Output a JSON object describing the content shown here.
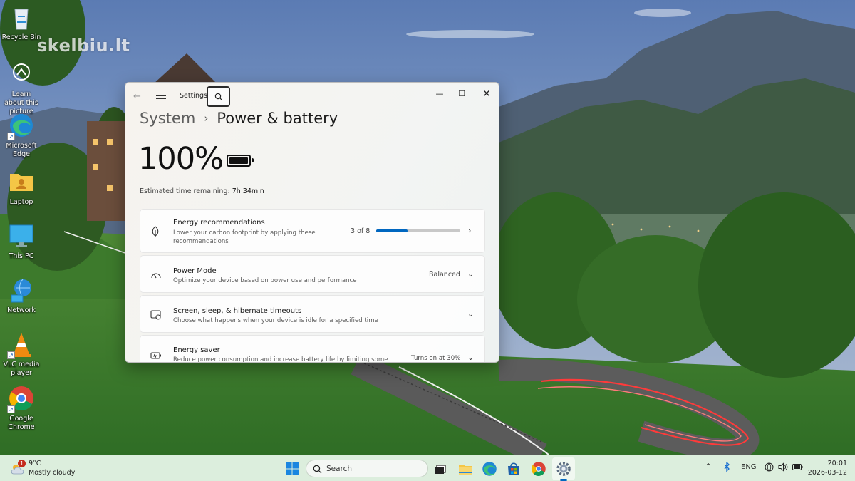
{
  "watermark": "skelbiu.lt",
  "desktop_icons": [
    {
      "label": "Recycle Bin",
      "icon": "recycle-bin-icon"
    },
    {
      "label": "Learn about this picture",
      "icon": "camera-info-icon"
    },
    {
      "label": "Microsoft Edge",
      "icon": "edge-icon"
    },
    {
      "label": "Laptop",
      "icon": "user-folder-icon"
    },
    {
      "label": "This PC",
      "icon": "monitor-icon"
    },
    {
      "label": "Network",
      "icon": "network-icon"
    },
    {
      "label": "VLC media player",
      "icon": "vlc-cone-icon"
    },
    {
      "label": "Google Chrome",
      "icon": "chrome-icon"
    }
  ],
  "settings": {
    "app_title": "Settings",
    "breadcrumb_parent": "System",
    "breadcrumb_current": "Power & battery",
    "battery_percent": "100%",
    "battery_level": 1.0,
    "estimate_label": "Estimated time remaining:",
    "estimate_value": "7h 34min",
    "cards": [
      {
        "icon": "leaf-icon",
        "title": "Energy recommendations",
        "subtitle": "Lower your carbon footprint by applying these recommendations",
        "value": "3 of 8",
        "progress": 0.375
      },
      {
        "icon": "power-mode-icon",
        "title": "Power Mode",
        "subtitle": "Optimize your device based on power use and performance",
        "value": "Balanced"
      },
      {
        "icon": "screen-sleep-icon",
        "title": "Screen, sleep, & hibernate timeouts",
        "subtitle": "Choose what happens when your device is idle for a specified time",
        "value": ""
      },
      {
        "icon": "energy-saver-icon",
        "title": "Energy saver",
        "subtitle": "Reduce power consumption and increase battery life by limiting some",
        "value": "Turns on at 30%"
      }
    ]
  },
  "taskbar": {
    "weather_temp": "9°C",
    "weather_cond": "Mostly cloudy",
    "weather_badge": "1",
    "search_placeholder": "Search",
    "pinned": [
      "start-icon",
      "task-view-icon",
      "file-explorer-icon",
      "edge-icon",
      "microsoft-store-icon",
      "chrome-icon",
      "settings-gear-icon"
    ],
    "tray_lang": "ENG",
    "time": "20:01",
    "date": "2026-03-12",
    "colors": {
      "accent": "#0067c0",
      "taskbar": "#dceedd"
    }
  }
}
